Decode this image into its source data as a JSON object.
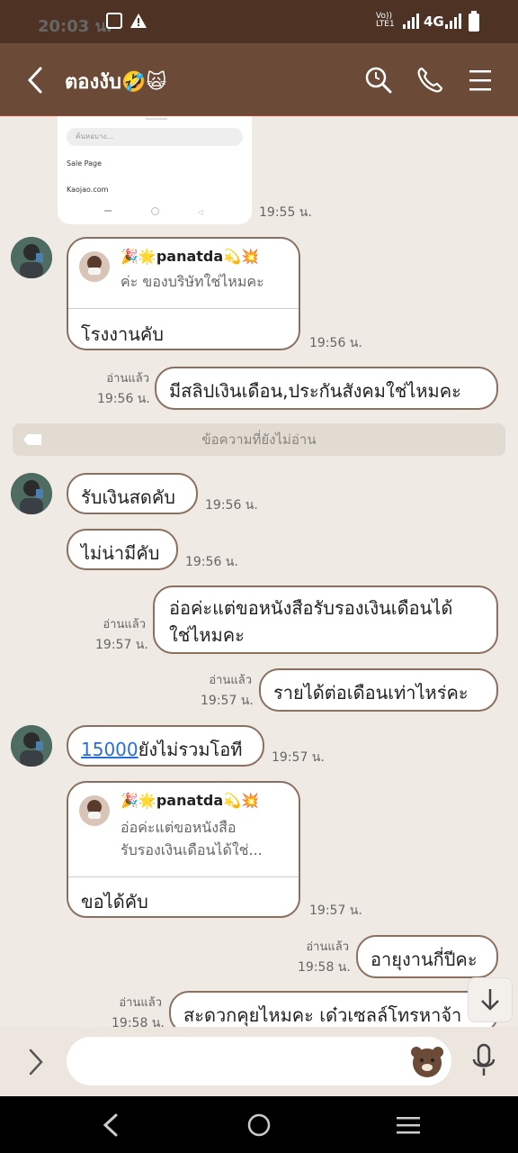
{
  "statusbar": {
    "time": "20:03 น.",
    "network": "4G",
    "volte": "Vo)) LTE1"
  },
  "header": {
    "title": "ตองงับ🤣🙀",
    "back_icon": "back-chevron-icon",
    "search_icon": "search-icon",
    "call_icon": "phone-icon",
    "menu_icon": "menu-icon"
  },
  "screenshot_preview": {
    "search_placeholder": "ค้นหอบาง...",
    "row1": "Sale Page",
    "row2": "Kaojao.com",
    "time": "19:55 น."
  },
  "messages": [
    {
      "quote_name": "🎉🌟panatda💫💥",
      "quote_text": "ค่ะ ของบริษัทใช่ไหมคะ",
      "text": "โรงงานคับ",
      "time": "19:56 น."
    },
    {
      "read": "อ่านแล้ว",
      "time": "19:56 น.",
      "text": "มีสลิปเงินเดือน,ประกันสังคมใช่ไหมคะ"
    },
    {
      "unread": "ข้อความที่ยังไม่อ่าน"
    },
    {
      "text": "รับเงินสดคับ",
      "time": "19:56 น."
    },
    {
      "text": "ไม่น่ามีคับ",
      "time": "19:56 น."
    },
    {
      "read": "อ่านแล้ว",
      "time": "19:57 น.",
      "text_line1": "อ่อค่ะแต่ขอหนังสือรับรองเงินเดือนได้",
      "text_line2": "ใช่ไหมคะ"
    },
    {
      "read": "อ่านแล้ว",
      "time": "19:57 น.",
      "text": "รายได้ต่อเดือนเท่าไหร่คะ"
    },
    {
      "link": "15000",
      "text": "ยังไม่รวมโอที",
      "time": "19:57 น."
    },
    {
      "quote_name": "🎉🌟panatda💫💥",
      "quote_line1": "อ่อค่ะแต่ขอหนังสือ",
      "quote_line2": "รับรองเงินเดือนได้ใช่...",
      "text": "ขอได้คับ",
      "time": "19:57 น."
    },
    {
      "read": "อ่านแล้ว",
      "time": "19:58 น.",
      "text": "อายุงานกี่ปีคะ"
    },
    {
      "read": "อ่านแล้ว",
      "time": "19:58 น.",
      "text": "สะดวกคุยไหมคะ เด๋วเซลล์โทรหาจ้า"
    }
  ],
  "inputbar": {
    "expand_icon": "chevron-right-icon",
    "sticker_icon": "bear-sticker-icon",
    "mic_icon": "mic-icon"
  },
  "colors": {
    "statusbar": "#4e3324",
    "header": "#6b4a37",
    "background": "#efeae3",
    "bubble_border": "#8b6f5f",
    "link": "#2a6fd6"
  }
}
